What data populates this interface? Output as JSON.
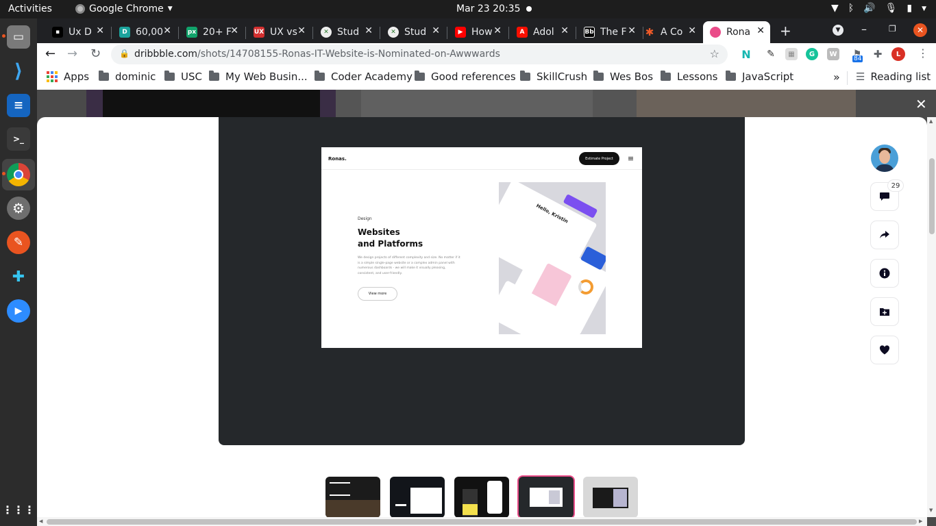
{
  "system_bar": {
    "activities": "Activities",
    "app_name": "Google Chrome",
    "clock": "Mar 23  20:35"
  },
  "tabs": [
    {
      "title": "Ux D",
      "favicon": "medium-icon"
    },
    {
      "title": "60,00",
      "favicon": "d-icon",
      "favicon_text": "D"
    },
    {
      "title": "20+ F",
      "favicon": "px-icon",
      "favicon_text": "px"
    },
    {
      "title": "UX vs",
      "favicon": "ux-icon",
      "favicon_text": "UX"
    },
    {
      "title": "Stud",
      "favicon": "globe-icon"
    },
    {
      "title": "Stud",
      "favicon": "globe-icon"
    },
    {
      "title": "How",
      "favicon": "youtube-icon"
    },
    {
      "title": "Adol",
      "favicon": "adobe-icon"
    },
    {
      "title": "The F",
      "favicon": "bb-icon",
      "favicon_text": "Bb"
    },
    {
      "title": "A Co",
      "favicon": "asterisk-icon",
      "favicon_text": "✱"
    },
    {
      "title": "Rona",
      "favicon": "dribbble-icon",
      "active": true
    }
  ],
  "address_bar": {
    "domain": "dribbble.com",
    "path": "/shots/14708155-Ronas-IT-Website-is-Nominated-on-Awwwards"
  },
  "extensions": {
    "badge_count": "84",
    "profile_letter": "L"
  },
  "bookmarks": {
    "apps_label": "Apps",
    "items": [
      "dominic",
      "USC",
      "My Web Busin...",
      "Coder Academy",
      "Good references",
      "SkillCrush",
      "Wes Bos",
      "Lessons",
      "JavaScript"
    ],
    "overflow": "»",
    "reading_list": "Reading list"
  },
  "shot": {
    "logo": "Ronas.",
    "cta": "Estimate Project",
    "eyebrow": "Design",
    "headline_line1": "Websites",
    "headline_line2": "and Platforms",
    "body": "We design projects of different complexity and size. No matter if it is a simple single-page website or a complex admin panel with numerous dashboards - we will make it visually pleasing, consistent, and user-friendly.",
    "button": "View more",
    "collage_greeting": "Hello, Kristin"
  },
  "actions": {
    "comment_count": "29"
  },
  "colors": {
    "dribbble_pink": "#ea4c89",
    "frame_dark": "#25282b",
    "ubuntu_orange": "#e95420"
  },
  "thumbnails": [
    {
      "label": "thumbnail-1"
    },
    {
      "label": "thumbnail-2"
    },
    {
      "label": "thumbnail-3"
    },
    {
      "label": "thumbnail-4",
      "active": true
    },
    {
      "label": "thumbnail-5"
    }
  ]
}
